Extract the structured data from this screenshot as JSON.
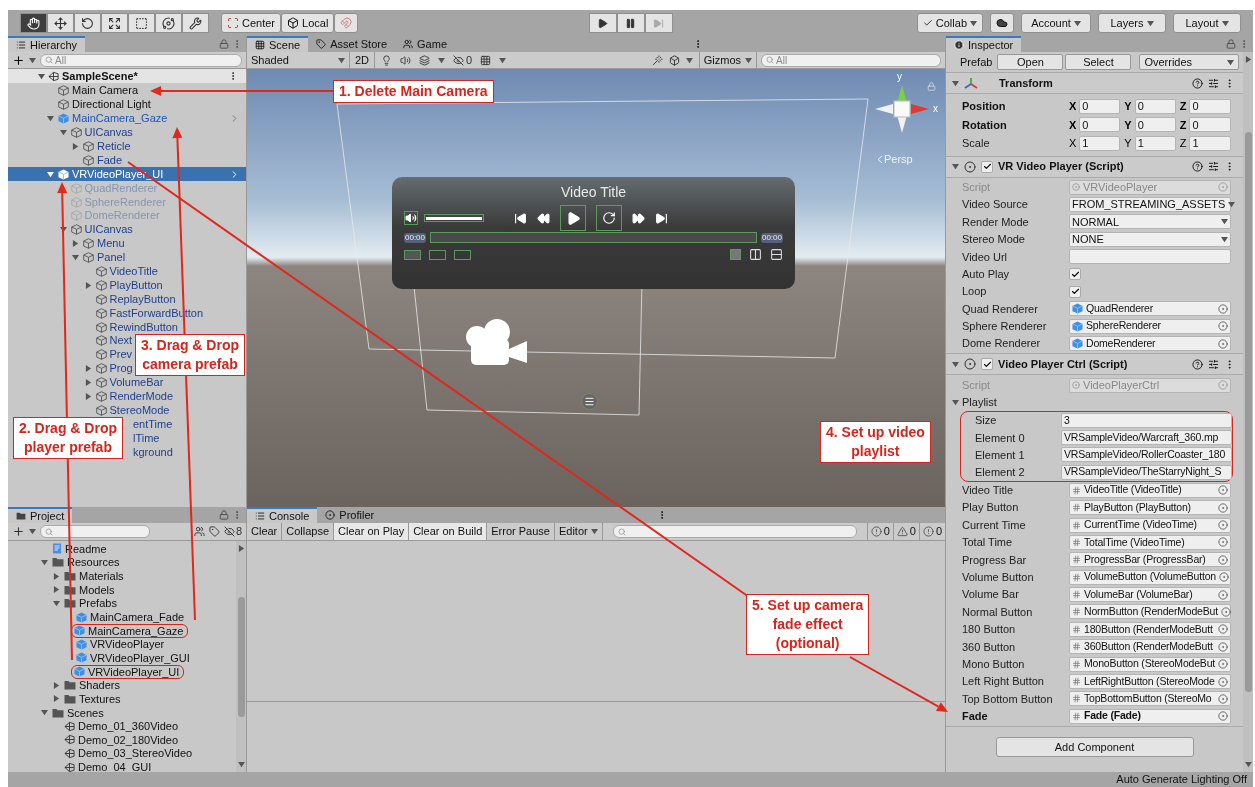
{
  "toolbar": {
    "tools": [
      {
        "selected": true
      },
      {
        "selected": false
      },
      {
        "selected": false
      },
      {
        "selected": false
      },
      {
        "selected": false
      },
      {
        "selected": false
      },
      {
        "selected": false
      }
    ],
    "pivot": [
      "Center",
      "Local"
    ],
    "playback": [
      {
        "disabled": false
      },
      {
        "disabled": false
      },
      {
        "disabled": true
      }
    ],
    "collab": "Collab",
    "account": "Account",
    "layers": "Layers",
    "layout": "Layout"
  },
  "hierarchy": {
    "tab": "Hierarchy",
    "search": {
      "placeholder": "All"
    },
    "scene": {
      "name": "SampleScene*",
      "expanded": true
    },
    "items": [
      {
        "name": "Main Camera",
        "kind": "object",
        "selected": false
      },
      {
        "name": "Directional Light",
        "kind": "object",
        "selected": false
      },
      {
        "name": "MainCamera_Gaze",
        "kind": "prefab",
        "selected": false,
        "expanded": true,
        "children": [
          {
            "name": "UICanvas",
            "kind": "prefab_child",
            "selected": false,
            "expanded": true,
            "children": [
              {
                "name": "Reticle",
                "kind": "prefab_child",
                "selected": false,
                "expanded": false
              },
              {
                "name": "Fade",
                "kind": "prefab_child",
                "selected": false
              }
            ]
          }
        ]
      },
      {
        "name": "VRVideoPlayer_UI",
        "kind": "prefab",
        "selected": true,
        "expanded": true,
        "children": [
          {
            "name": "QuadRenderer",
            "kind": "inactive",
            "selected": false
          },
          {
            "name": "SphereRenderer",
            "kind": "inactive",
            "selected": false
          },
          {
            "name": "DomeRenderer",
            "kind": "inactive",
            "selected": false
          },
          {
            "name": "UICanvas",
            "kind": "prefab_child",
            "selected": false,
            "expanded": true,
            "children": [
              {
                "name": "Menu",
                "kind": "prefab_child",
                "selected": false,
                "expanded": false
              },
              {
                "name": "Panel",
                "kind": "prefab_child",
                "selected": false,
                "expanded": true,
                "children": [
                  {
                    "name": "VideoTitle",
                    "kind": "prefab_child",
                    "selected": false
                  },
                  {
                    "name": "PlayButton",
                    "kind": "prefab_child",
                    "selected": false,
                    "expanded": false
                  },
                  {
                    "name": "ReplayButton",
                    "kind": "prefab_child",
                    "selected": false
                  },
                  {
                    "name": "FastForwardButton",
                    "kind": "prefab_child",
                    "selected": false
                  },
                  {
                    "name": "RewindButton",
                    "kind": "prefab_child",
                    "selected": false
                  },
                  {
                    "name": "Next",
                    "kind": "prefab_child",
                    "selected": false
                  },
                  {
                    "name": "Prev",
                    "kind": "prefab_child",
                    "selected": false
                  },
                  {
                    "name": "Prog",
                    "kind": "prefab_child",
                    "selected": false,
                    "expanded": false
                  },
                  {
                    "name": "VolumeBar",
                    "kind": "prefab_child",
                    "selected": false,
                    "expanded": false
                  },
                  {
                    "name": "RenderMode",
                    "kind": "prefab_child",
                    "selected": false,
                    "expanded": false
                  },
                  {
                    "name": "StereoMode",
                    "kind": "prefab_child",
                    "selected": false
                  },
                  {
                    "name": "entTime",
                    "kind": "covered_child",
                    "selected": false
                  },
                  {
                    "name": "lTime",
                    "kind": "covered_child",
                    "selected": false
                  },
                  {
                    "name": "kground",
                    "kind": "covered_child",
                    "selected": false
                  }
                ]
              }
            ]
          }
        ]
      }
    ]
  },
  "scene_view": {
    "tabs": [
      {
        "label": "Scene",
        "selected": true
      },
      {
        "label": "Asset Store",
        "selected": false
      },
      {
        "label": "Game",
        "selected": false
      }
    ],
    "shading": "Shaded",
    "mode_2d": "2D",
    "hidden_count": "0",
    "gizmos": "Gizmos",
    "search": {
      "placeholder": "All"
    },
    "gizmo_axes": [
      "y",
      "x"
    ],
    "projection": "Persp",
    "player": {
      "title": "Video Title",
      "volume": {
        "level": 1
      },
      "current_time": "00:00",
      "total_time": "00:00"
    }
  },
  "project": {
    "tab": "Project",
    "hidden_count": "8",
    "items": [
      {
        "name": "Readme",
        "kind": "file"
      },
      {
        "name": "Resources",
        "kind": "folder",
        "expanded": true,
        "children": [
          {
            "name": "Materials",
            "kind": "folder",
            "expanded": false
          },
          {
            "name": "Models",
            "kind": "folder",
            "expanded": false
          },
          {
            "name": "Prefabs",
            "kind": "folder",
            "expanded": true,
            "children": [
              {
                "name": "MainCamera_Fade",
                "kind": "prefab",
                "circled": false
              },
              {
                "name": "MainCamera_Gaze",
                "kind": "prefab",
                "circled": true
              },
              {
                "name": "VRVideoPlayer",
                "kind": "prefab",
                "circled": false
              },
              {
                "name": "VRVideoPlayer_GUI",
                "kind": "prefab",
                "circled": false
              },
              {
                "name": "VRVideoPlayer_UI",
                "kind": "prefab",
                "circled": true
              }
            ]
          },
          {
            "name": "Shaders",
            "kind": "folder",
            "expanded": false
          },
          {
            "name": "Textures",
            "kind": "folder",
            "expanded": false
          }
        ]
      },
      {
        "name": "Scenes",
        "kind": "folder",
        "expanded": true,
        "children": [
          {
            "name": "Demo_01_360Video",
            "kind": "scene"
          },
          {
            "name": "Demo_02_180Video",
            "kind": "scene"
          },
          {
            "name": "Demo_03_StereoVideo",
            "kind": "scene"
          },
          {
            "name": "Demo_04_GUI",
            "kind": "scene"
          }
        ]
      }
    ]
  },
  "console": {
    "tabs": [
      {
        "label": "Console",
        "selected": true
      },
      {
        "label": "Profiler",
        "selected": false
      }
    ],
    "buttons": [
      {
        "label": "Clear",
        "selected": false
      },
      {
        "label": "Collapse",
        "selected": false
      },
      {
        "label": "Clear on Play",
        "selected": true
      },
      {
        "label": "Clear on Build",
        "selected": true
      },
      {
        "label": "Error Pause",
        "selected": false
      }
    ],
    "editor": "Editor",
    "counts": [
      {
        "kind": "info",
        "value": "0"
      },
      {
        "kind": "warning",
        "value": "0"
      },
      {
        "kind": "error",
        "value": "0"
      }
    ]
  },
  "inspector": {
    "tab": "Inspector",
    "prefab": {
      "label": "Prefab",
      "buttons": [
        "Open",
        "Select"
      ],
      "overrides": "Overrides"
    },
    "components": [
      {
        "kind": "transform",
        "title": "Transform",
        "expanded": true,
        "rows": [
          {
            "kind": "vector",
            "label": "Position",
            "overridden": true,
            "values": [
              {
                "axis": "X",
                "value": "0"
              },
              {
                "axis": "Y",
                "value": "0"
              },
              {
                "axis": "Z",
                "value": "0"
              }
            ]
          },
          {
            "kind": "vector",
            "label": "Rotation",
            "overridden": true,
            "values": [
              {
                "axis": "X",
                "value": "0"
              },
              {
                "axis": "Y",
                "value": "0"
              },
              {
                "axis": "Z",
                "value": "0"
              }
            ]
          },
          {
            "kind": "vector",
            "label": "Scale",
            "overridden": false,
            "values": [
              {
                "axis": "X",
                "value": "1"
              },
              {
                "axis": "Y",
                "value": "1"
              },
              {
                "axis": "Z",
                "value": "1"
              }
            ]
          }
        ]
      },
      {
        "kind": "script",
        "title": "VR Video Player (Script)",
        "expanded": true,
        "enabled": true,
        "rows": [
          {
            "kind": "script",
            "label": "Script",
            "value": "VRVideoPlayer",
            "disabled": true
          },
          {
            "kind": "dropdown",
            "label": "Video Source",
            "value": "FROM_STREAMING_ASSETS"
          },
          {
            "kind": "dropdown",
            "label": "Render Mode",
            "value": "NORMAL"
          },
          {
            "kind": "dropdown",
            "label": "Stereo Mode",
            "value": "NONE"
          },
          {
            "kind": "text",
            "label": "Video Url"
          },
          {
            "kind": "checkbox",
            "label": "Auto Play",
            "checked": true
          },
          {
            "kind": "checkbox",
            "label": "Loop",
            "checked": true
          },
          {
            "kind": "prefab_ref",
            "label": "Quad Renderer",
            "value": "QuadRenderer",
            "overridden": false
          },
          {
            "kind": "prefab_ref",
            "label": "Sphere Renderer",
            "value": "SphereRenderer",
            "overridden": false
          },
          {
            "kind": "prefab_ref",
            "label": "Dome Renderer",
            "value": "DomeRenderer",
            "overridden": false
          }
        ]
      },
      {
        "kind": "script",
        "title": "Video Player Ctrl (Script)",
        "expanded": true,
        "enabled": true,
        "rows": [
          {
            "kind": "script",
            "label": "Script",
            "value": "VideoPlayerCtrl",
            "disabled": true
          },
          {
            "kind": "list",
            "label": "Playlist",
            "expanded": true,
            "circled": true,
            "items": [
              {
                "label": "Size",
                "value": "3"
              },
              {
                "label": "Element 0",
                "value": "VRSampleVideo/Warcraft_360.mp"
              },
              {
                "label": "Element 1",
                "value": "VRSampleVideo/RollerCoaster_180"
              },
              {
                "label": "Element 2",
                "value": "VRSampleVideo/TheStarryNight_S"
              }
            ]
          },
          {
            "kind": "script_ref",
            "label": "Video Title",
            "value": "VideoTitle (VideoTitle)",
            "overridden": false
          },
          {
            "kind": "script_ref",
            "label": "Play Button",
            "value": "PlayButton (PlayButton)",
            "overridden": false
          },
          {
            "kind": "script_ref",
            "label": "Current Time",
            "value": "CurrentTime (VideoTime)",
            "overridden": false
          },
          {
            "kind": "script_ref",
            "label": "Total Time",
            "value": "TotalTime (VideoTime)",
            "overridden": false
          },
          {
            "kind": "script_ref",
            "label": "Progress Bar",
            "value": "ProgressBar (ProgressBar)",
            "overridden": false
          },
          {
            "kind": "script_ref",
            "label": "Volume Button",
            "value": "VolumeButton (VolumeButton",
            "overridden": false
          },
          {
            "kind": "script_ref",
            "label": "Volume Bar",
            "value": "VolumeBar (VolumeBar)",
            "overridden": false
          },
          {
            "kind": "script_ref",
            "label": "Normal Button",
            "value": "NormButton (RenderModeBut",
            "overridden": false
          },
          {
            "kind": "script_ref",
            "label": "180 Button",
            "value": "180Button (RenderModeButt",
            "overridden": false
          },
          {
            "kind": "script_ref",
            "label": "360 Button",
            "value": "360Button (RenderModeButt",
            "overridden": false
          },
          {
            "kind": "script_ref",
            "label": "Mono Button",
            "value": "MonoButton (StereoModeBut",
            "overridden": false
          },
          {
            "kind": "script_ref",
            "label": "Left Right Button",
            "value": "LeftRightButton (StereoMode",
            "overridden": false
          },
          {
            "kind": "script_ref",
            "label": "Top Bottom Button",
            "value": "TopBottomButton (StereoMo",
            "overridden": false
          },
          {
            "kind": "script_ref",
            "label": "Fade",
            "value": "Fade (Fade)",
            "overridden": true
          }
        ]
      }
    ],
    "add_component": "Add Component"
  },
  "status_bar": "Auto Generate Lighting Off",
  "callouts": [
    "1. Delete Main Camera",
    "2. Drag & Drop\nplayer prefab",
    "3. Drag & Drop\ncamera prefab",
    "4. Set up video\nplaylist",
    "5. Set up camera\nfade effect\n(optional)"
  ]
}
